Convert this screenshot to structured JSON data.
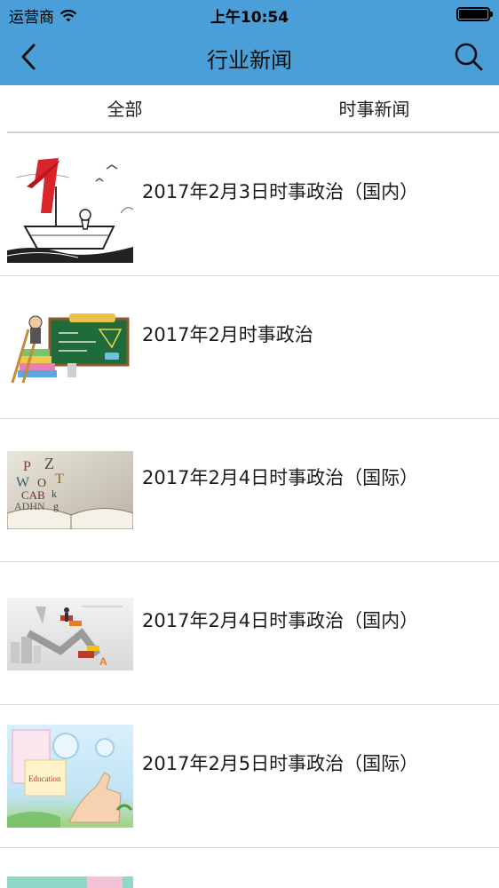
{
  "status": {
    "carrier": "运营商",
    "time": "上午10:54"
  },
  "nav": {
    "title": "行业新闻"
  },
  "tabs": [
    {
      "label": "全部"
    },
    {
      "label": "时事新闻"
    }
  ],
  "items": [
    {
      "title": "2017年2月3日时事政治（国内）",
      "thumbnail": "boat-with-red-A-illustration"
    },
    {
      "title": "2017年2月时事政治",
      "thumbnail": "student-chalkboard-books-illustration"
    },
    {
      "title": "2017年2月4日时事政治（国际）",
      "thumbnail": "open-book-letters-illustration"
    },
    {
      "title": "2017年2月4日时事政治（国内）",
      "thumbnail": "city-stairs-illustration"
    },
    {
      "title": "2017年2月5日时事政治（国际）",
      "thumbnail": "hand-education-illustration"
    },
    {
      "title": "",
      "thumbnail": "partial-thumbnail"
    }
  ],
  "colors": {
    "header": "#4a9fd8",
    "divider": "#d8d8d8"
  }
}
